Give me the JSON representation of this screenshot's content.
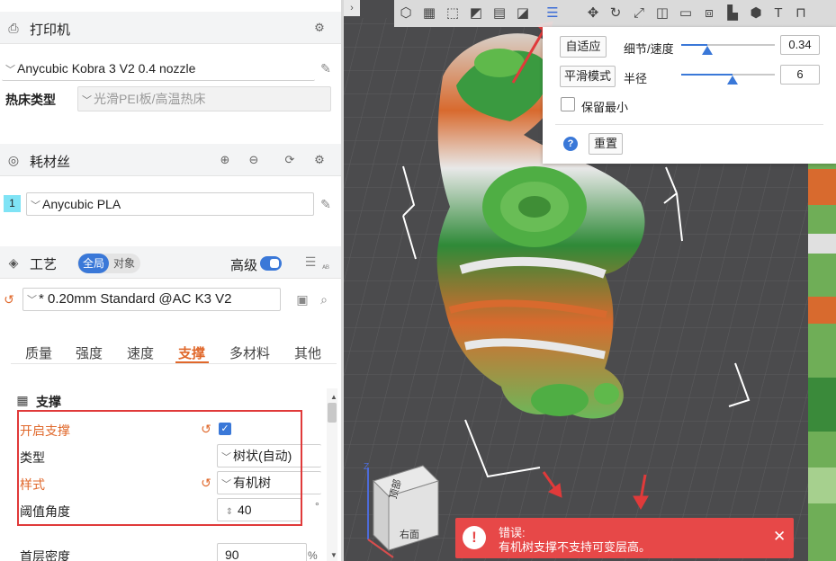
{
  "printer": {
    "title": "打印机",
    "profile": "Anycubic Kobra 3 V2 0.4 nozzle",
    "bed_label": "热床类型",
    "bed_value": "光滑PEI板/高温热床"
  },
  "filament": {
    "title": "耗材丝",
    "slot": "1",
    "slot_color": "#7fe3f5",
    "value": "Anycubic PLA"
  },
  "process": {
    "title": "工艺",
    "toggle_global": "全局",
    "toggle_object": "对象",
    "advanced_label": "高级",
    "advanced_on": true,
    "preset": "* 0.20mm Standard @AC K3 V2"
  },
  "tabs": [
    {
      "label": "质量",
      "active": false
    },
    {
      "label": "强度",
      "active": false
    },
    {
      "label": "速度",
      "active": false
    },
    {
      "label": "支撑",
      "active": true
    },
    {
      "label": "多材料",
      "active": false
    },
    {
      "label": "其他",
      "active": false
    }
  ],
  "support": {
    "section_title": "支撑",
    "enable_label": "开启支撑",
    "enable_checked": true,
    "type_label": "类型",
    "type_value": "树状(自动)",
    "style_label": "样式",
    "style_value": "有机树",
    "threshold_label": "阈值角度",
    "threshold_value": "40",
    "threshold_unit": "°",
    "first_layer_label": "首层密度",
    "first_layer_value": "90",
    "first_layer_unit": "%"
  },
  "popup": {
    "adaptive_button": "自适应",
    "detail_label": "细节/速度",
    "detail_value": "0.34",
    "detail_level": 0.28,
    "smooth_button": "平滑模式",
    "radius_label": "半径",
    "radius_value": "6",
    "radius_level": 0.55,
    "keep_min_label": "保留最小",
    "keep_min_checked": false,
    "reset_button": "重置"
  },
  "navcube": {
    "top_face": "顶部",
    "front_face": "右面",
    "z_axis": "Z"
  },
  "error": {
    "title": "错误:",
    "message": "有机树支撑不支持可变层高。"
  },
  "colors": {
    "accent_orange": "#e0682b",
    "accent_blue": "#3a78d8",
    "error_red": "#e74848",
    "highlight_box": "#e03a3a"
  }
}
